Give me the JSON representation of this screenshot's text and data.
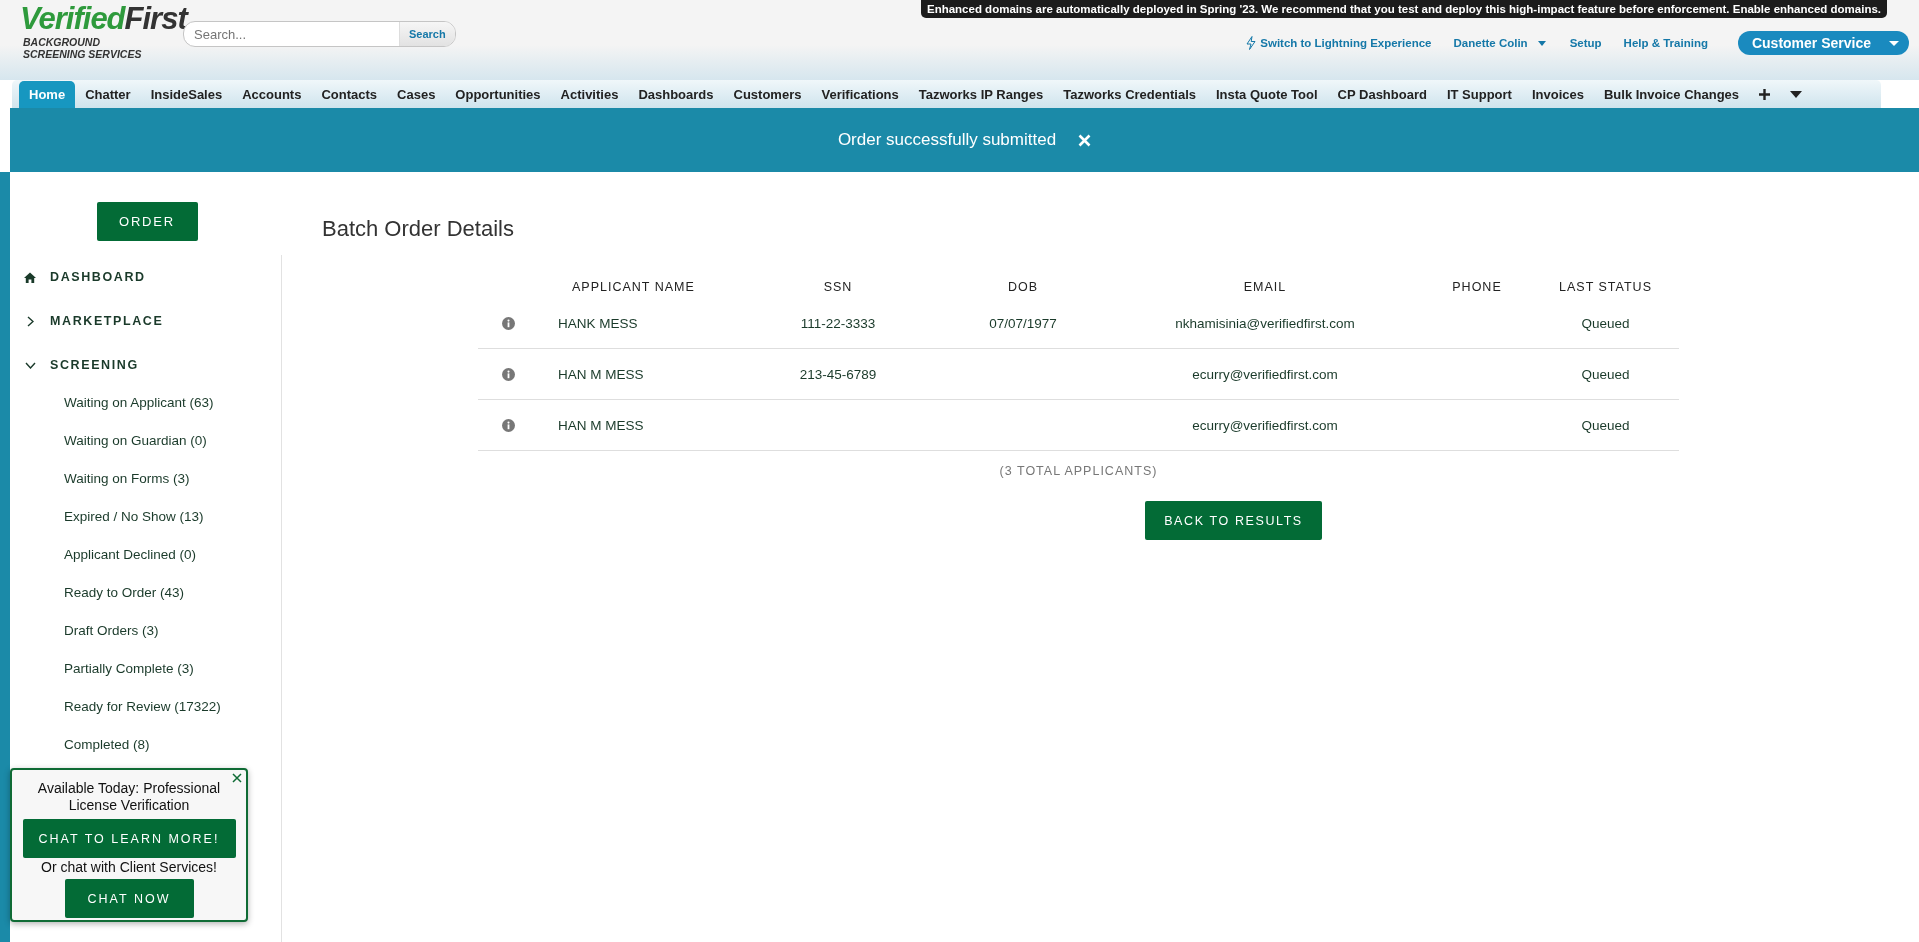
{
  "notice": "Enhanced domains are automatically deployed in Spring '23. We recommend that you test and deploy this high-impact feature before enforcement. Enable enhanced domains.",
  "logo": {
    "brand_primary": "Verified",
    "brand_secondary": "First",
    "tagline": [
      "BACKGROUND",
      "SCREENING SERVICES"
    ]
  },
  "search": {
    "placeholder": "Search...",
    "button": "Search"
  },
  "header_links": [
    {
      "label": "Switch to Lightning Experience",
      "kind": "lightning"
    },
    {
      "label": "Danette Colin",
      "kind": "menu"
    },
    {
      "label": "Setup",
      "kind": "plain"
    },
    {
      "label": "Help & Training",
      "kind": "plain"
    }
  ],
  "app_switcher": {
    "label": "Customer Service"
  },
  "tabs": [
    {
      "label": "Home",
      "selected": true
    },
    {
      "label": "Chatter",
      "selected": false
    },
    {
      "label": "InsideSales",
      "selected": false
    },
    {
      "label": "Accounts",
      "selected": false
    },
    {
      "label": "Contacts",
      "selected": false
    },
    {
      "label": "Cases",
      "selected": false
    },
    {
      "label": "Opportunities",
      "selected": false
    },
    {
      "label": "Activities",
      "selected": false
    },
    {
      "label": "Dashboards",
      "selected": false
    },
    {
      "label": "Customers",
      "selected": false
    },
    {
      "label": "Verifications",
      "selected": false
    },
    {
      "label": "Tazworks IP Ranges",
      "selected": false
    },
    {
      "label": "Tazworks Credentials",
      "selected": false
    },
    {
      "label": "Insta Quote Tool",
      "selected": false
    },
    {
      "label": "CP Dashboard",
      "selected": false
    },
    {
      "label": "IT Support",
      "selected": false
    },
    {
      "label": "Invoices",
      "selected": false
    },
    {
      "label": "Bulk Invoice Changes",
      "selected": false
    }
  ],
  "banner": {
    "message": "Order successfully submitted"
  },
  "sidebar": {
    "order_button": "ORDER",
    "items": [
      {
        "label": "DASHBOARD",
        "kind": "home"
      },
      {
        "label": "MARKETPLACE",
        "kind": "group",
        "expanded": false
      },
      {
        "label": "SCREENING",
        "kind": "group",
        "expanded": true,
        "children": [
          {
            "label": "Waiting on Applicant (63)"
          },
          {
            "label": "Waiting on Guardian (0)"
          },
          {
            "label": "Waiting on Forms (3)"
          },
          {
            "label": "Expired / No Show (13)"
          },
          {
            "label": "Applicant Declined (0)"
          },
          {
            "label": "Ready to Order (43)"
          },
          {
            "label": "Draft Orders (3)"
          },
          {
            "label": "Partially Complete (3)"
          },
          {
            "label": "Ready for Review (17322)"
          },
          {
            "label": "Completed (8)"
          }
        ]
      }
    ]
  },
  "page_title": "Batch Order Details",
  "table": {
    "columns": [
      "APPLICANT NAME",
      "SSN",
      "DOB",
      "EMAIL",
      "PHONE",
      "LAST STATUS"
    ],
    "rows": [
      {
        "applicant_name": "HANK MESS",
        "ssn": "111-22-3333",
        "dob": "07/07/1977",
        "email": "nkhamisinia@verifiedfirst.com",
        "last_status": "Queued"
      },
      {
        "applicant_name": "HAN M MESS",
        "ssn": "213-45-6789",
        "email": "ecurry@verifiedfirst.com",
        "last_status": "Queued"
      },
      {
        "applicant_name": "HAN M MESS",
        "email": "ecurry@verifiedfirst.com",
        "last_status": "Queued"
      }
    ]
  },
  "total": "(3 TOTAL APPLICANTS)",
  "back_button": "BACK TO RESULTS",
  "chat_popup": {
    "headline": "Available Today: Professional License Verification",
    "learn_button": "CHAT TO LEARN MORE!",
    "subline": "Or chat with Client Services!",
    "chat_button": "CHAT NOW"
  }
}
